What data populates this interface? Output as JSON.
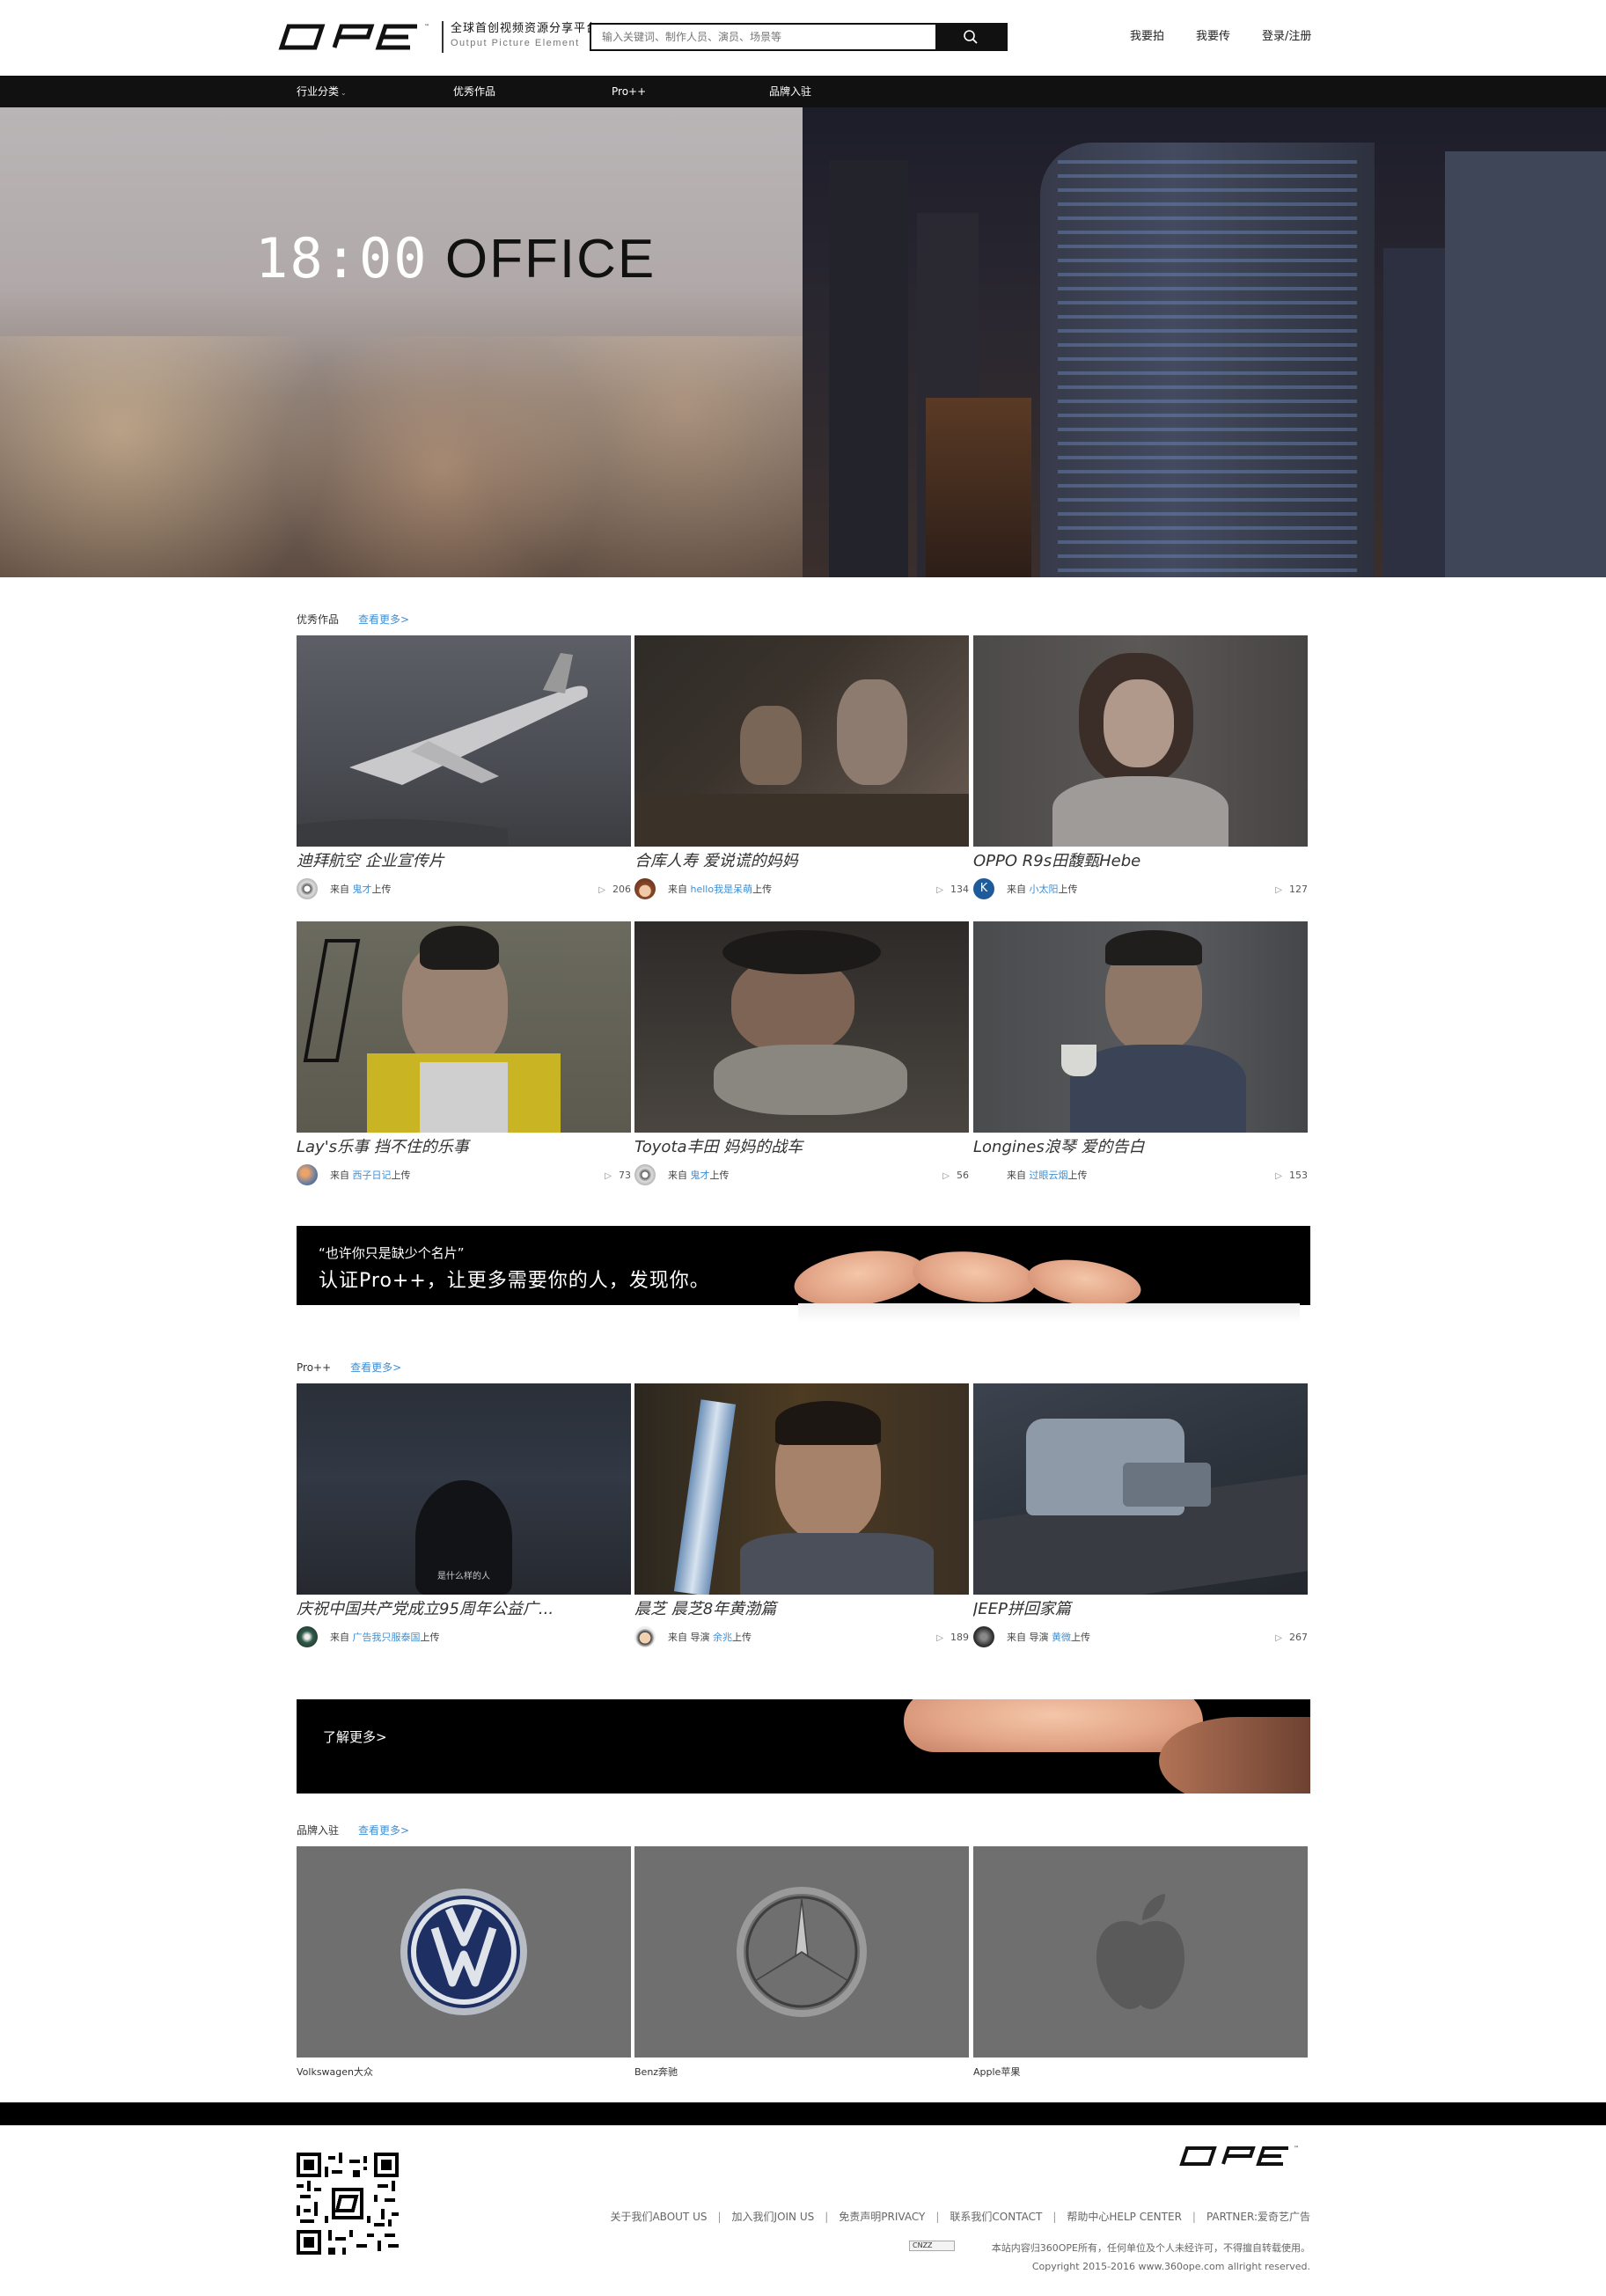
{
  "header": {
    "slogan_cn": "全球首创视频资源分享平台",
    "slogan_en": "Output Picture Element",
    "search_placeholder": "输入关键词、制作人员、演员、场景等",
    "links": [
      "我要拍",
      "我要传",
      "登录/注册"
    ]
  },
  "nav": {
    "items": [
      "行业分类",
      "优秀作品",
      "Pro++",
      "品牌入驻"
    ]
  },
  "hero": {
    "time": "18:00",
    "word": "OFFICE"
  },
  "featured": {
    "title": "优秀作品",
    "more": "查看更多>",
    "cards": [
      {
        "title": "迪拜航空 企业宣传片",
        "from": "来自",
        "author": "鬼才",
        "suffix": "上传",
        "views": "206"
      },
      {
        "title": "合库人寿 爱说谎的妈妈",
        "from": "来自",
        "author": "hello我是呆萌",
        "suffix": "上传",
        "views": "134"
      },
      {
        "title": "OPPO R9s田馥甄Hebe",
        "from": "来自",
        "author": "小太阳",
        "suffix": "上传",
        "views": "127"
      },
      {
        "title": "Lay's乐事 挡不住的乐事",
        "from": "来自",
        "author": "西子日记",
        "suffix": "上传",
        "views": "73"
      },
      {
        "title": "Toyota丰田 妈妈的战车",
        "from": "来自",
        "author": "鬼才",
        "suffix": "上传",
        "views": "56"
      },
      {
        "title": "Longines浪琴 爱的告白",
        "from": "来自",
        "author": "过眼云烟",
        "suffix": "上传",
        "views": "153"
      }
    ]
  },
  "banner1": {
    "quote": "“也许你只是缺少个名片”",
    "text": "认证Pro++，让更多需要你的人，发现你。"
  },
  "pro": {
    "title": "Pro++",
    "more": "查看更多>",
    "cards": [
      {
        "title": "庆祝中国共产党成立95周年公益广...",
        "from": "来自",
        "author": "广告我只服泰国",
        "suffix": "上传",
        "views": "",
        "caption": "是什么样的人"
      },
      {
        "title": "晨芝 晨芝8年黄渤篇",
        "from": "来自 导演",
        "author": "余兆",
        "suffix": "上传",
        "views": "189"
      },
      {
        "title": "JEEP拼回家篇",
        "from": "来自 导演",
        "author": "黄微",
        "suffix": "上传",
        "views": "267"
      }
    ]
  },
  "banner2": {
    "text": "了解更多>"
  },
  "brands": {
    "title": "品牌入驻",
    "more": "查看更多>",
    "items": [
      {
        "name": "Volkswagen大众",
        "icon": "volkswagen-logo-icon"
      },
      {
        "name": "Benz奔驰",
        "icon": "mercedes-logo-icon"
      },
      {
        "name": "Apple苹果",
        "icon": "apple-logo-icon"
      }
    ]
  },
  "footer": {
    "links": [
      "关于我们ABOUT US",
      "加入我们JOIN US",
      "免责声明PRIVACY",
      "联系我们CONTACT",
      "帮助中心HELP CENTER",
      "PARTNER:爱奇艺广告"
    ],
    "separator": "|",
    "cnzz": "CNZZ",
    "notice": "本站内容归360OPE所有，任何单位及个人未经许可，不得擅自转载使用。",
    "copyright": "Copyright 2015-2016 www.360ope.com allright reserved."
  },
  "colors": {
    "accent": "#3e8fd5",
    "nav_bg": "#111111",
    "banner_bg": "#000000"
  }
}
